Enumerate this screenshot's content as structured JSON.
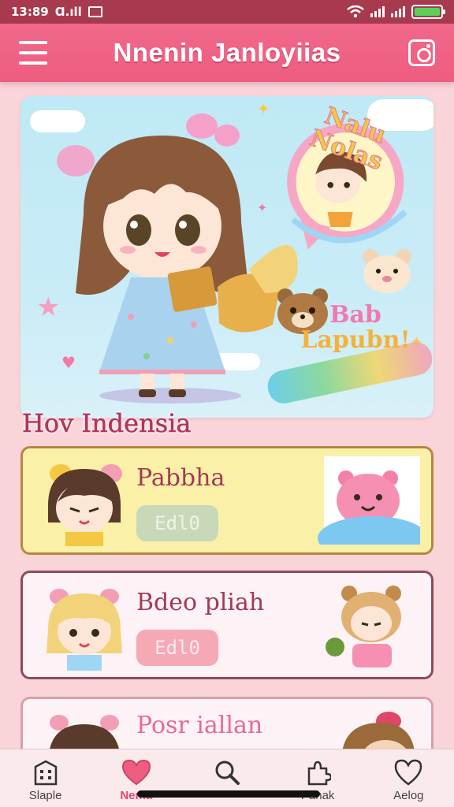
{
  "status_bar": {
    "time": "13:89",
    "carrier": "Ɑ.ıll"
  },
  "header": {
    "title": "Nnenin Janloyiias"
  },
  "hero": {
    "bubble_text": "Nalu Nolas",
    "banner_line1": "Bab",
    "banner_line2": "Lapubn!"
  },
  "section": {
    "title": "Hov Indensia"
  },
  "cards": [
    {
      "title": "Pabbha",
      "badge": "Edl0"
    },
    {
      "title": "Bdeo pliah",
      "badge": "Edl0"
    },
    {
      "title": "Posr iallan"
    }
  ],
  "nav": [
    {
      "label": "Slaple",
      "icon": "building-icon"
    },
    {
      "label": "Nema",
      "icon": "heart-icon"
    },
    {
      "label": "",
      "icon": "search-icon"
    },
    {
      "label": "Panak",
      "icon": "puzzle-icon"
    },
    {
      "label": "Aelog",
      "icon": "heart-outline-icon"
    }
  ],
  "colors": {
    "header": "#ee5d80",
    "status_bar": "#a83a4f",
    "background": "#f9d4d8",
    "accent": "#e24673"
  }
}
